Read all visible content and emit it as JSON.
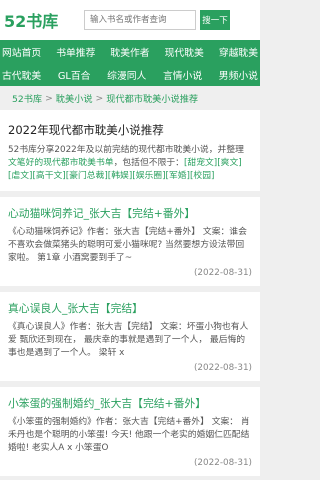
{
  "header": {
    "logo": "52书库",
    "search_placeholder": "输入书名或作者查询",
    "search_button": "搜一下"
  },
  "nav": {
    "row1": [
      "网站首页",
      "书单推荐",
      "耽美作者",
      "现代耽美",
      "穿越耽美"
    ],
    "row2": [
      "古代耽美",
      "GL百合",
      "综漫同人",
      "言情小说",
      "男频小说"
    ]
  },
  "breadcrumb": {
    "home": "52书库",
    "sep": ">",
    "level2": "耽美小说",
    "level3": "现代都市耽美小说推荐"
  },
  "intro": {
    "title": "2022年现代都市耽美小说推荐",
    "text_before": "52书库分享2022年及以前完结的现代都市耽美小说，并整理",
    "text_link": "文笔好的现代都市耽美书单",
    "text_after": "，包括但不限于：",
    "tags": [
      "[甜宠文]",
      "[爽文]",
      "[虐文]",
      "[高干文]",
      "[豪门总裁]",
      "[韩娱]",
      "[娱乐圈]",
      "[军婚]",
      "[校园]"
    ]
  },
  "items": [
    {
      "title": "心动猫咪饲养记_张大吉【完结+番外】",
      "body": "《心动猫咪饲养记》作者：张大吉【完结+番外】 文案：谁会不喜欢会做菜猪头的聪明可爱小猫咪呢? 当然要想方设法带回家啦。 第1章 小酒窝要到手了~",
      "date": "(2022-08-31)"
    },
    {
      "title": "真心误良人_张大吉【完结】",
      "body": "《真心误良人》作者：张大吉【完结】 文案：坏蛋小狗也有人爱 甄欣还到现在， 最庆幸的事就是遇到了一个人， 最后悔的事也是遇到了一个人。 梁轩 x",
      "date": "(2022-08-31)"
    },
    {
      "title": "小笨蛋的强制婚约_张大吉【完结+番外】",
      "body": "《小笨蛋的强制婚约》作者：张大吉【完结+番外】 文案： 肖禾丹也是个聪明的小笨蛋! 今天! 他跟一个老实的婚姻仁匹配结婚啦! 老实人A x 小笨蛋O",
      "date": "(2022-08-31)"
    }
  ]
}
